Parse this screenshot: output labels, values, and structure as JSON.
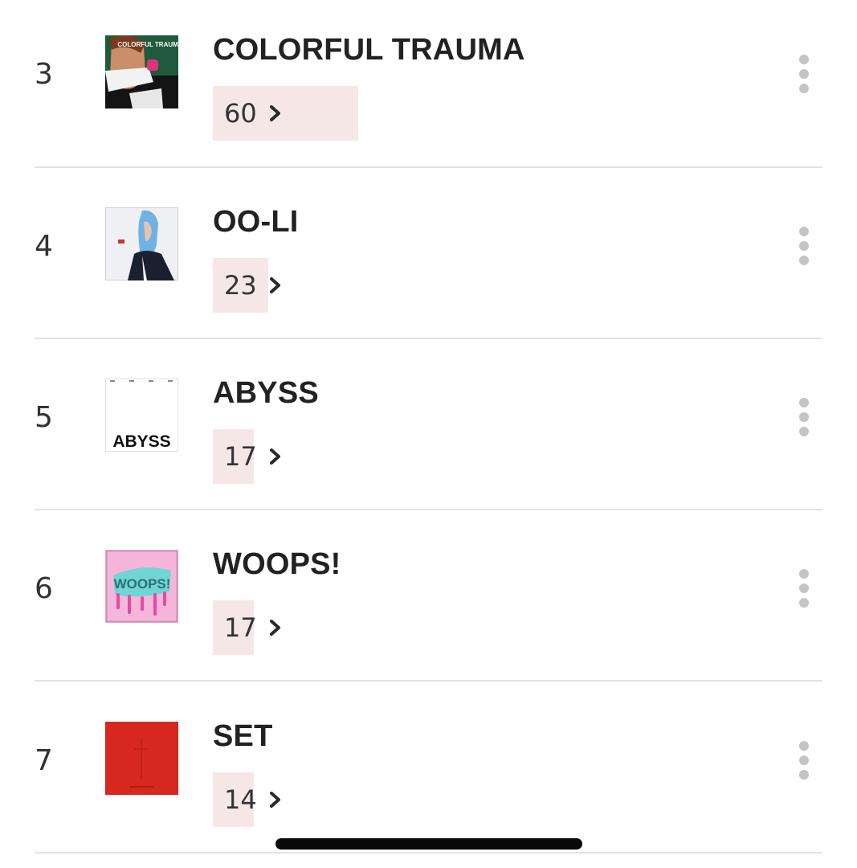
{
  "chart": {
    "rows": [
      {
        "rank": "3",
        "title": "COLORFUL TRAUMA",
        "count": "60",
        "count_fill": 1.0,
        "cover_icon": "album-cover-colorful-trauma",
        "cover_text": "COLORFUL TRAUMA"
      },
      {
        "rank": "4",
        "title": "OO-LI",
        "count": "23",
        "count_fill": 0.38,
        "cover_icon": "album-cover-oo-li"
      },
      {
        "rank": "5",
        "title": "ABYSS",
        "count": "17",
        "count_fill": 0.28,
        "cover_icon": "album-cover-abyss",
        "cover_text": "ABYSS"
      },
      {
        "rank": "6",
        "title": "WOOPS!",
        "count": "17",
        "count_fill": 0.28,
        "cover_icon": "album-cover-woops",
        "cover_text": "WOOPS!"
      },
      {
        "rank": "7",
        "title": "SET",
        "count": "14",
        "count_fill": 0.23,
        "cover_icon": "album-cover-set"
      }
    ],
    "more_icon": "more-vertical-icon",
    "chevron_icon": "chevron-right-icon"
  },
  "colors": {
    "count_highlight": "#f6e7e7",
    "divider": "#e3e3e3",
    "more_dots": "#c4c4c4",
    "home_indicator": "#0a0a0a"
  }
}
